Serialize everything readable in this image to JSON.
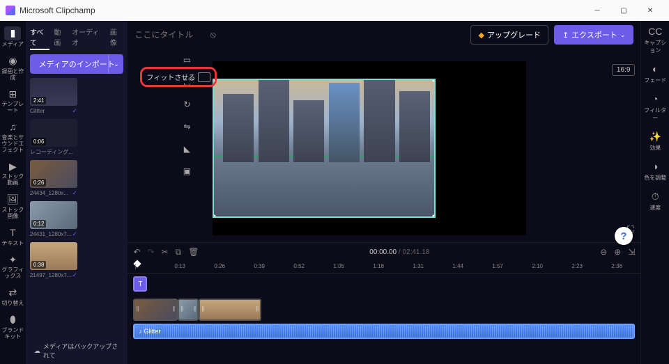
{
  "titlebar": {
    "app_name": "Microsoft Clipchamp"
  },
  "leftrail": [
    {
      "icon": "folder",
      "label": "メディア",
      "active": true
    },
    {
      "icon": "rec",
      "label": "録画と作成"
    },
    {
      "icon": "template",
      "label": "テンプレート"
    },
    {
      "icon": "music",
      "label": "音楽とサウンドエフェクト"
    },
    {
      "icon": "video",
      "label": "ストック動画"
    },
    {
      "icon": "image",
      "label": "ストック画像"
    },
    {
      "icon": "text",
      "label": "テキスト"
    },
    {
      "icon": "graphics",
      "label": "グラフィックス"
    },
    {
      "icon": "transition",
      "label": "切り替え"
    },
    {
      "icon": "brand",
      "label": "ブランドキット"
    }
  ],
  "mediatabs": [
    {
      "label": "すべて",
      "active": true
    },
    {
      "label": "動画"
    },
    {
      "label": "オーディオ"
    },
    {
      "label": "画像"
    }
  ],
  "import_label": "メディアのインポート",
  "clips": [
    {
      "name": "Glitter",
      "duration": "2:41",
      "bg": "linear-gradient(180deg,#2b2b45,#3b3b58)",
      "checked": true
    },
    {
      "name": "レコーディング...",
      "duration": "0:06",
      "bg": "#1e1e30"
    },
    {
      "name": "24434_1280x...",
      "duration": "0:26",
      "bg": "linear-gradient(135deg,#7a5c3e,#4a4a5e)",
      "checked": true
    },
    {
      "name": "24431_1280x7...",
      "duration": "0:12",
      "bg": "linear-gradient(135deg,#8a9aa8,#5a6a78)",
      "checked": true
    },
    {
      "name": "21497_1280x7...",
      "duration": "0:38",
      "bg": "linear-gradient(180deg,#c4a67a,#9a7a5a)",
      "checked": true
    }
  ],
  "project_title_placeholder": "ここにタイトル",
  "upgrade_label": "アップグレード",
  "export_label": "エクスポート",
  "fit_label": "フィットさせる",
  "ratio_label": "16:9",
  "rightrail": [
    {
      "icon": "cc",
      "label": "キャプション"
    },
    {
      "icon": "fade",
      "label": "フェード"
    },
    {
      "icon": "filter",
      "label": "フィルター"
    },
    {
      "icon": "fx",
      "label": "効果"
    },
    {
      "icon": "adjust",
      "label": "色を調整"
    },
    {
      "icon": "speed",
      "label": "速度"
    }
  ],
  "time_current": "00:00.00",
  "time_total": "02:41.18",
  "ruler_ticks": [
    "|",
    "0:13",
    "0:26",
    "0:39",
    "0:52",
    "1:05",
    "1:18",
    "1:31",
    "1:44",
    "1:57",
    "2:10",
    "2:23",
    "2:36"
  ],
  "audio_clip_label": "Glitter",
  "backup_label": "メディアはバックアップされて"
}
